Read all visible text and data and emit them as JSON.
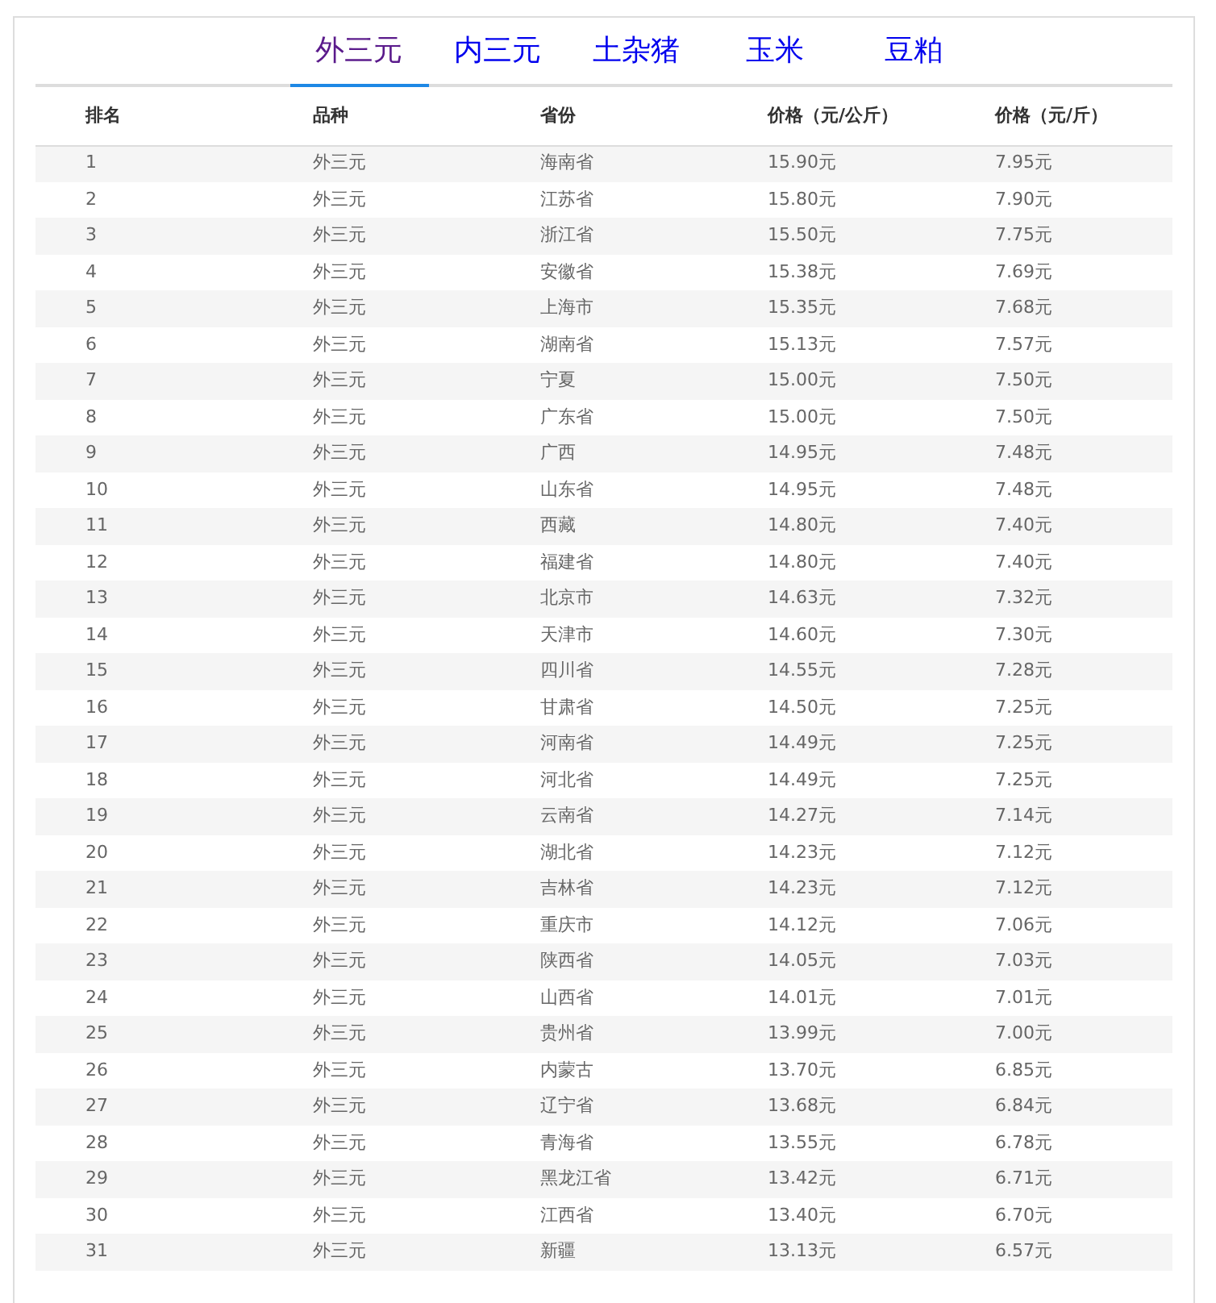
{
  "tabs": [
    {
      "label": "外三元",
      "selected": true
    },
    {
      "label": "内三元",
      "selected": false
    },
    {
      "label": "土杂猪",
      "selected": false
    },
    {
      "label": "玉米",
      "selected": false
    },
    {
      "label": "豆粕",
      "selected": false
    }
  ],
  "table": {
    "columns": [
      "排名",
      "品种",
      "省份",
      "价格（元/公斤）",
      "价格（元/斤）"
    ],
    "rows": [
      [
        "1",
        "外三元",
        "海南省",
        "15.90元",
        "7.95元"
      ],
      [
        "2",
        "外三元",
        "江苏省",
        "15.80元",
        "7.90元"
      ],
      [
        "3",
        "外三元",
        "浙江省",
        "15.50元",
        "7.75元"
      ],
      [
        "4",
        "外三元",
        "安徽省",
        "15.38元",
        "7.69元"
      ],
      [
        "5",
        "外三元",
        "上海市",
        "15.35元",
        "7.68元"
      ],
      [
        "6",
        "外三元",
        "湖南省",
        "15.13元",
        "7.57元"
      ],
      [
        "7",
        "外三元",
        "宁夏",
        "15.00元",
        "7.50元"
      ],
      [
        "8",
        "外三元",
        "广东省",
        "15.00元",
        "7.50元"
      ],
      [
        "9",
        "外三元",
        "广西",
        "14.95元",
        "7.48元"
      ],
      [
        "10",
        "外三元",
        "山东省",
        "14.95元",
        "7.48元"
      ],
      [
        "11",
        "外三元",
        "西藏",
        "14.80元",
        "7.40元"
      ],
      [
        "12",
        "外三元",
        "福建省",
        "14.80元",
        "7.40元"
      ],
      [
        "13",
        "外三元",
        "北京市",
        "14.63元",
        "7.32元"
      ],
      [
        "14",
        "外三元",
        "天津市",
        "14.60元",
        "7.30元"
      ],
      [
        "15",
        "外三元",
        "四川省",
        "14.55元",
        "7.28元"
      ],
      [
        "16",
        "外三元",
        "甘肃省",
        "14.50元",
        "7.25元"
      ],
      [
        "17",
        "外三元",
        "河南省",
        "14.49元",
        "7.25元"
      ],
      [
        "18",
        "外三元",
        "河北省",
        "14.49元",
        "7.25元"
      ],
      [
        "19",
        "外三元",
        "云南省",
        "14.27元",
        "7.14元"
      ],
      [
        "20",
        "外三元",
        "湖北省",
        "14.23元",
        "7.12元"
      ],
      [
        "21",
        "外三元",
        "吉林省",
        "14.23元",
        "7.12元"
      ],
      [
        "22",
        "外三元",
        "重庆市",
        "14.12元",
        "7.06元"
      ],
      [
        "23",
        "外三元",
        "陕西省",
        "14.05元",
        "7.03元"
      ],
      [
        "24",
        "外三元",
        "山西省",
        "14.01元",
        "7.01元"
      ],
      [
        "25",
        "外三元",
        "贵州省",
        "13.99元",
        "7.00元"
      ],
      [
        "26",
        "外三元",
        "内蒙古",
        "13.70元",
        "6.85元"
      ],
      [
        "27",
        "外三元",
        "辽宁省",
        "13.68元",
        "6.84元"
      ],
      [
        "28",
        "外三元",
        "青海省",
        "13.55元",
        "6.78元"
      ],
      [
        "29",
        "外三元",
        "黑龙江省",
        "13.42元",
        "6.71元"
      ],
      [
        "30",
        "外三元",
        "江西省",
        "13.40元",
        "6.70元"
      ],
      [
        "31",
        "外三元",
        "新疆",
        "13.13元",
        "6.57元"
      ]
    ]
  }
}
